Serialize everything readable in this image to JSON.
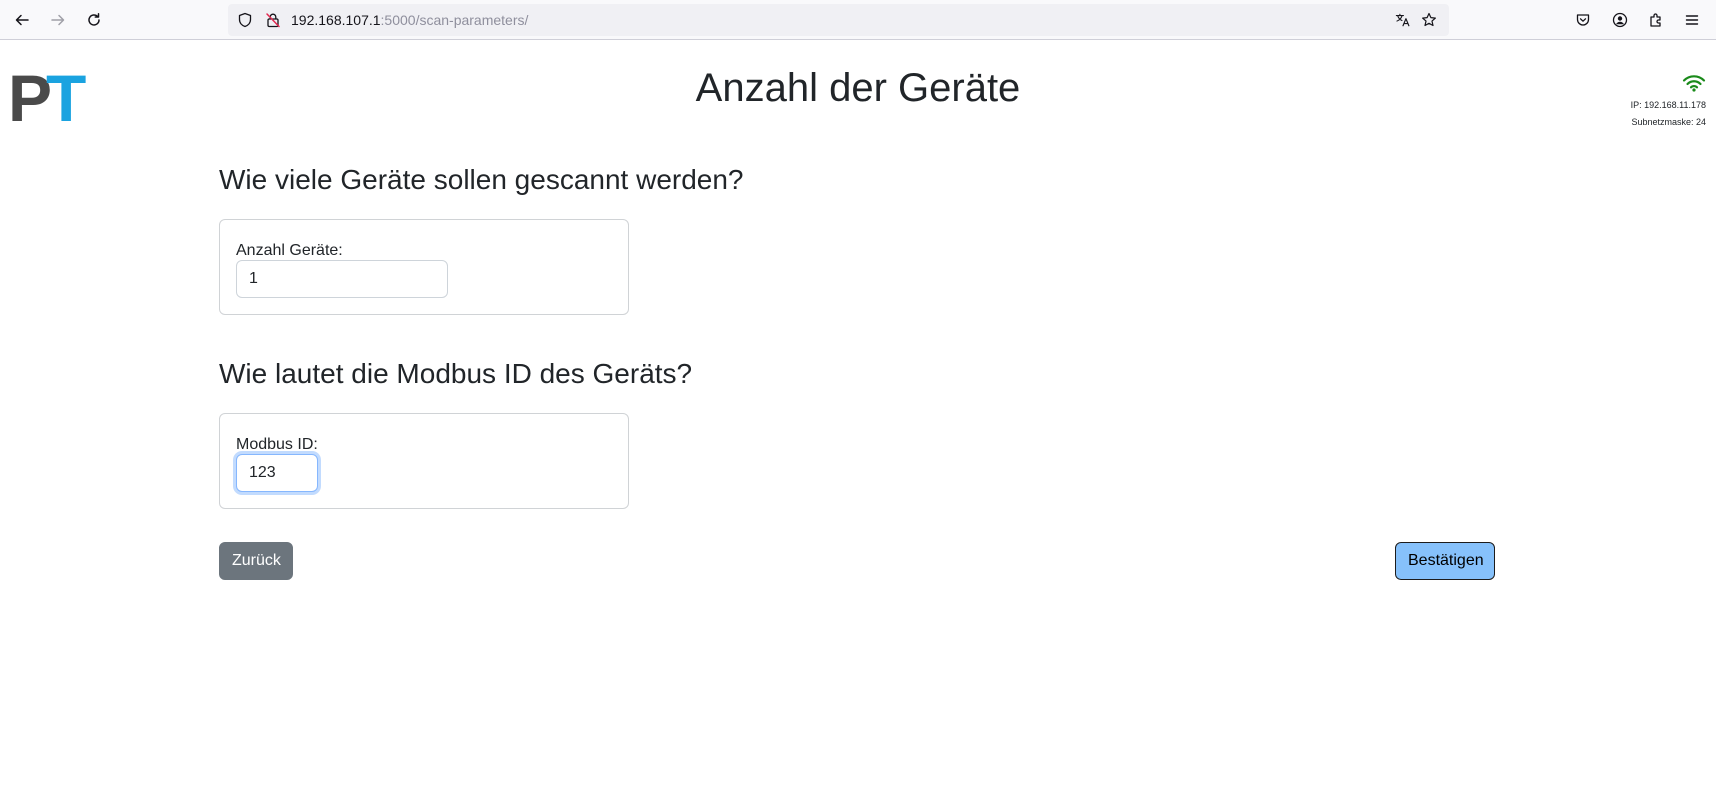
{
  "browser": {
    "url_host": "192.168.107.1",
    "url_path": ":5000/scan-parameters/"
  },
  "header": {
    "logo_letter_1": "P",
    "logo_letter_2": "T",
    "title": "Anzahl der Geräte"
  },
  "network": {
    "ip_text": "IP: 192.168.11.178",
    "subnet_text": "Subnetzmaske: 24",
    "status_color": "#1a8a1a"
  },
  "device_count_section": {
    "heading": "Wie viele Geräte sollen gescannt werden?",
    "label": "Anzahl Geräte:",
    "value": "1"
  },
  "modbus_section": {
    "heading": "Wie lautet die Modbus ID des Geräts?",
    "label": "Modbus ID:",
    "value": "123"
  },
  "actions": {
    "back_label": "Zurück",
    "confirm_label": "Bestätigen"
  },
  "colors": {
    "accent": "#1aa3e0",
    "back_button": "#6c757d",
    "confirm_button": "#86c1fb"
  }
}
